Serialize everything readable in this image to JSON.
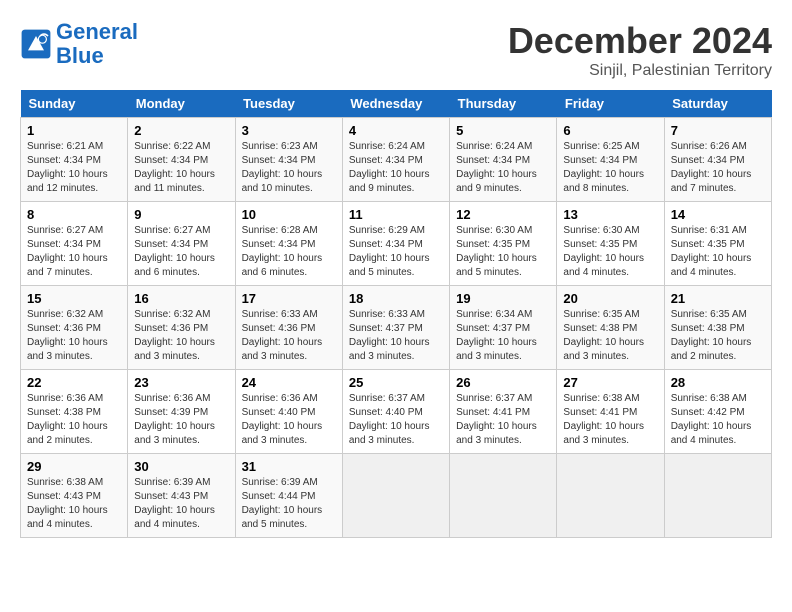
{
  "header": {
    "logo_line1": "General",
    "logo_line2": "Blue",
    "month_title": "December 2024",
    "subtitle": "Sinjil, Palestinian Territory"
  },
  "days_of_week": [
    "Sunday",
    "Monday",
    "Tuesday",
    "Wednesday",
    "Thursday",
    "Friday",
    "Saturday"
  ],
  "weeks": [
    [
      {
        "day": "1",
        "sunrise": "6:21 AM",
        "sunset": "4:34 PM",
        "daylight": "10 hours and 12 minutes."
      },
      {
        "day": "2",
        "sunrise": "6:22 AM",
        "sunset": "4:34 PM",
        "daylight": "10 hours and 11 minutes."
      },
      {
        "day": "3",
        "sunrise": "6:23 AM",
        "sunset": "4:34 PM",
        "daylight": "10 hours and 10 minutes."
      },
      {
        "day": "4",
        "sunrise": "6:24 AM",
        "sunset": "4:34 PM",
        "daylight": "10 hours and 9 minutes."
      },
      {
        "day": "5",
        "sunrise": "6:24 AM",
        "sunset": "4:34 PM",
        "daylight": "10 hours and 9 minutes."
      },
      {
        "day": "6",
        "sunrise": "6:25 AM",
        "sunset": "4:34 PM",
        "daylight": "10 hours and 8 minutes."
      },
      {
        "day": "7",
        "sunrise": "6:26 AM",
        "sunset": "4:34 PM",
        "daylight": "10 hours and 7 minutes."
      }
    ],
    [
      {
        "day": "8",
        "sunrise": "6:27 AM",
        "sunset": "4:34 PM",
        "daylight": "10 hours and 7 minutes."
      },
      {
        "day": "9",
        "sunrise": "6:27 AM",
        "sunset": "4:34 PM",
        "daylight": "10 hours and 6 minutes."
      },
      {
        "day": "10",
        "sunrise": "6:28 AM",
        "sunset": "4:34 PM",
        "daylight": "10 hours and 6 minutes."
      },
      {
        "day": "11",
        "sunrise": "6:29 AM",
        "sunset": "4:34 PM",
        "daylight": "10 hours and 5 minutes."
      },
      {
        "day": "12",
        "sunrise": "6:30 AM",
        "sunset": "4:35 PM",
        "daylight": "10 hours and 5 minutes."
      },
      {
        "day": "13",
        "sunrise": "6:30 AM",
        "sunset": "4:35 PM",
        "daylight": "10 hours and 4 minutes."
      },
      {
        "day": "14",
        "sunrise": "6:31 AM",
        "sunset": "4:35 PM",
        "daylight": "10 hours and 4 minutes."
      }
    ],
    [
      {
        "day": "15",
        "sunrise": "6:32 AM",
        "sunset": "4:36 PM",
        "daylight": "10 hours and 3 minutes."
      },
      {
        "day": "16",
        "sunrise": "6:32 AM",
        "sunset": "4:36 PM",
        "daylight": "10 hours and 3 minutes."
      },
      {
        "day": "17",
        "sunrise": "6:33 AM",
        "sunset": "4:36 PM",
        "daylight": "10 hours and 3 minutes."
      },
      {
        "day": "18",
        "sunrise": "6:33 AM",
        "sunset": "4:37 PM",
        "daylight": "10 hours and 3 minutes."
      },
      {
        "day": "19",
        "sunrise": "6:34 AM",
        "sunset": "4:37 PM",
        "daylight": "10 hours and 3 minutes."
      },
      {
        "day": "20",
        "sunrise": "6:35 AM",
        "sunset": "4:38 PM",
        "daylight": "10 hours and 3 minutes."
      },
      {
        "day": "21",
        "sunrise": "6:35 AM",
        "sunset": "4:38 PM",
        "daylight": "10 hours and 2 minutes."
      }
    ],
    [
      {
        "day": "22",
        "sunrise": "6:36 AM",
        "sunset": "4:38 PM",
        "daylight": "10 hours and 2 minutes."
      },
      {
        "day": "23",
        "sunrise": "6:36 AM",
        "sunset": "4:39 PM",
        "daylight": "10 hours and 3 minutes."
      },
      {
        "day": "24",
        "sunrise": "6:36 AM",
        "sunset": "4:40 PM",
        "daylight": "10 hours and 3 minutes."
      },
      {
        "day": "25",
        "sunrise": "6:37 AM",
        "sunset": "4:40 PM",
        "daylight": "10 hours and 3 minutes."
      },
      {
        "day": "26",
        "sunrise": "6:37 AM",
        "sunset": "4:41 PM",
        "daylight": "10 hours and 3 minutes."
      },
      {
        "day": "27",
        "sunrise": "6:38 AM",
        "sunset": "4:41 PM",
        "daylight": "10 hours and 3 minutes."
      },
      {
        "day": "28",
        "sunrise": "6:38 AM",
        "sunset": "4:42 PM",
        "daylight": "10 hours and 4 minutes."
      }
    ],
    [
      {
        "day": "29",
        "sunrise": "6:38 AM",
        "sunset": "4:43 PM",
        "daylight": "10 hours and 4 minutes."
      },
      {
        "day": "30",
        "sunrise": "6:39 AM",
        "sunset": "4:43 PM",
        "daylight": "10 hours and 4 minutes."
      },
      {
        "day": "31",
        "sunrise": "6:39 AM",
        "sunset": "4:44 PM",
        "daylight": "10 hours and 5 minutes."
      },
      null,
      null,
      null,
      null
    ]
  ]
}
